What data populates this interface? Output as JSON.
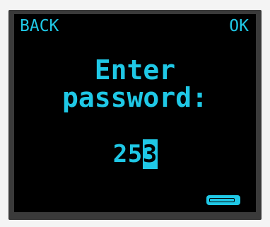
{
  "softkeys": {
    "left_label": "BACK",
    "right_label": "OK"
  },
  "prompt": {
    "line1": "Enter",
    "line2": "password:"
  },
  "password_entry": {
    "digits": [
      "2",
      "5",
      "3"
    ],
    "active_index": 2
  },
  "colors": {
    "foreground": "#1fc8e6",
    "background": "#000000"
  },
  "icons": {
    "battery": "battery-icon"
  }
}
